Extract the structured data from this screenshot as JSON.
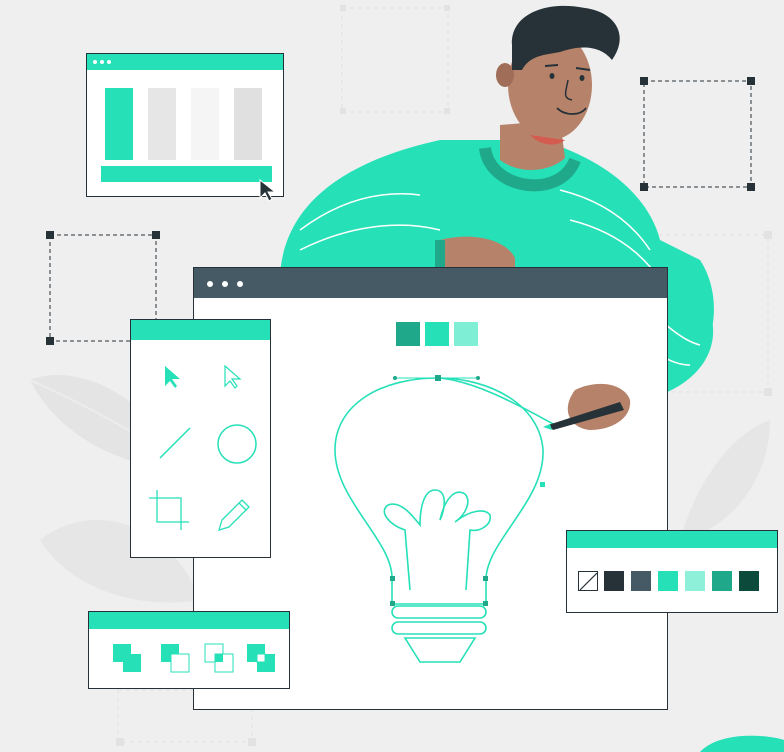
{
  "colors": {
    "accent": "#26e0b8",
    "accent_dark": "#1fa88a",
    "accent_light": "#7eeed5",
    "dark": "#263238",
    "window_bar": "#455a64",
    "background": "#efefef",
    "skin": "#b7826a"
  },
  "illustration": {
    "subject": "designer-drawing-lightbulb",
    "main_canvas": {
      "titlebar_dots": 3,
      "top_swatches": [
        "#1fa88a",
        "#26e0b8",
        "#7eeed5"
      ]
    },
    "layout_window": {
      "titlebar_dots": 3,
      "columns": [
        "#26e0b8",
        "#e6e6e6",
        "#f5f5f5",
        "#e0e0e0"
      ]
    },
    "tools_panel": {
      "tools": [
        "select-arrow-icon",
        "direct-select-icon",
        "line-icon",
        "ellipse-icon",
        "crop-icon",
        "pen-icon"
      ]
    },
    "pathfinder_panel": {
      "icons": [
        "unite-icon",
        "minus-front-icon",
        "intersect-icon",
        "exclude-icon"
      ]
    },
    "color_palette": {
      "swatches": [
        "none",
        "#263238",
        "#455a64",
        "#26e0b8",
        "#8ff0d9",
        "#1fa88a",
        "#0c4a3c"
      ]
    }
  }
}
